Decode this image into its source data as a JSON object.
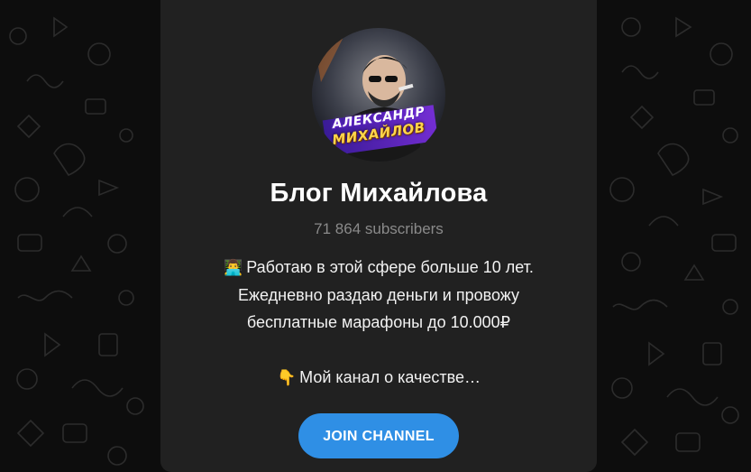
{
  "channel": {
    "avatar_line1": "АЛЕКСАНДР",
    "avatar_line2": "МИХАЙЛОВ",
    "title": "Блог Михайлова",
    "subscribers": "71 864 subscribers",
    "description": {
      "line1_emoji": "👨‍💻",
      "line1": "Работаю в этой сфере больше 10 лет.",
      "line2": "Ежедневно раздаю деньги и провожу",
      "line3": "бесплатные марафоны до 10.000₽",
      "line4_emoji": "👇",
      "line4": "Мой канал о качестве…"
    },
    "join_label": "JOIN CHANNEL"
  },
  "colors": {
    "background": "#0d0d0d",
    "card": "#212121",
    "accent": "#2f8fe5",
    "muted_text": "#8a8a8a"
  }
}
